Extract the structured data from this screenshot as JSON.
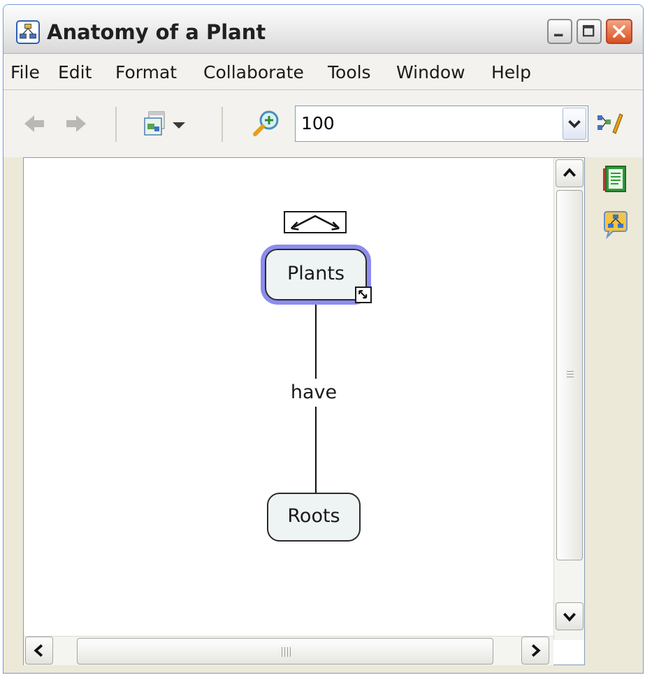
{
  "window": {
    "title": "Anatomy of a Plant",
    "icons": {
      "app": "concept-map-icon",
      "minimize": "minimize-icon",
      "maximize": "maximize-icon",
      "close": "close-icon"
    }
  },
  "menu": {
    "items": [
      "File",
      "Edit",
      "Format",
      "Collaborate",
      "Tools",
      "Window",
      "Help"
    ]
  },
  "toolbar": {
    "icons": [
      "back-arrow-icon",
      "forward-arrow-icon",
      "new-map-icon",
      "dropdown-arrow-icon",
      "zoom-icon",
      "properties-icon"
    ],
    "zoom_value": "100"
  },
  "side_panel": {
    "icons": [
      "notes-icon",
      "collaboration-icon"
    ]
  },
  "concept_map": {
    "concepts": [
      "Plants",
      "Roots"
    ],
    "link_phrase": "have",
    "selected_concept": "Plants"
  },
  "colors": {
    "selection": "#8c8cf0",
    "concept_fill": "#eef3f3",
    "close_button": "#d9501f"
  }
}
